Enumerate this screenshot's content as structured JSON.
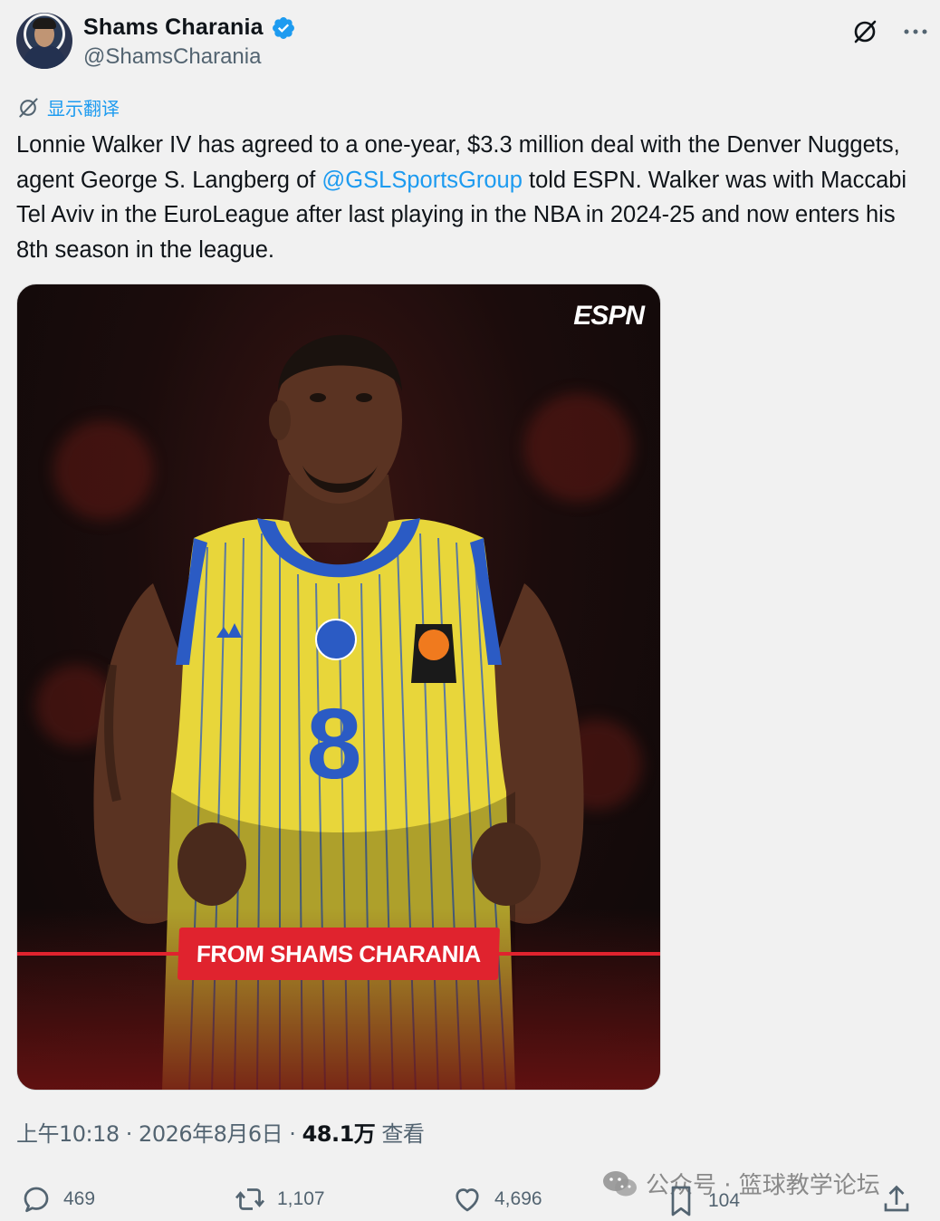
{
  "author": {
    "display_name": "Shams Charania",
    "handle": "@ShamsCharania",
    "verified": true
  },
  "translate_label": "显示翻译",
  "tweet": {
    "text_before_mention": "Lonnie Walker IV has agreed to a one-year, $3.3 million deal with the Denver Nuggets, agent George S. Langberg of ",
    "mention": "@GSLSportsGroup",
    "text_after_mention": " told ESPN. Walker was with Maccabi Tel Aviv in the EuroLeague after last playing in the NBA in 2024-25 and now enters his 8th season in the league."
  },
  "media": {
    "logo_text": "ESPN",
    "jersey_number": "8",
    "banner_text": "FROM SHAMS CHARANIA"
  },
  "meta": {
    "time_date": "上午10:18 · 2026年8月6日 · ",
    "views_count": "48.1万",
    "views_label": " 查看"
  },
  "actions": {
    "replies": "469",
    "reposts": "1,107",
    "likes": "4,696",
    "bookmarks": "104"
  },
  "watermark": "公众号 · 篮球教学论坛",
  "colors": {
    "link_blue": "#1d9bf0",
    "banner_red": "#e0232e",
    "muted_gray": "#536471",
    "jersey_yellow": "#e8d63a",
    "jersey_blue": "#2b5bc4"
  }
}
